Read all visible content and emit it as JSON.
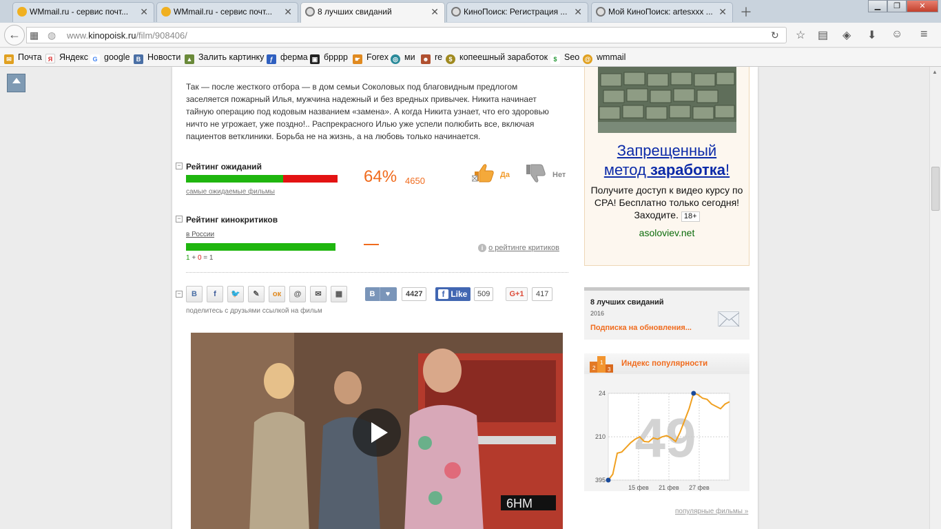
{
  "browser": {
    "tabs": [
      {
        "title": "WMmail.ru - сервис почт...",
        "active": false
      },
      {
        "title": "WMmail.ru - сервис почт...",
        "active": false
      },
      {
        "title": "8 лучших свиданий",
        "active": true
      },
      {
        "title": "КиноПоиск: Регистрация ...",
        "active": false
      },
      {
        "title": "Мой КиноПоиск: artesxxx ...",
        "active": false
      }
    ],
    "url_plain": "www.",
    "url_domain": "kinopoisk.ru",
    "url_path": "/film/908406/",
    "bookmarks": [
      {
        "label": "Почта",
        "icon": "mail-icon",
        "color": "#e0a020"
      },
      {
        "label": "Яндекс",
        "icon": "yandex-icon",
        "color": "#d92c2c"
      },
      {
        "label": "google",
        "icon": "google-icon",
        "color": "#4285f4"
      },
      {
        "label": "Новости",
        "icon": "vk-icon",
        "color": "#4a6fa5"
      },
      {
        "label": "Залить картинку",
        "icon": "upload-icon",
        "color": "#6a8a3a"
      },
      {
        "label": "ферма",
        "icon": "farm-icon",
        "color": "#3060c0"
      },
      {
        "label": "бpppp",
        "icon": "film-icon",
        "color": "#222222"
      },
      {
        "label": "Forex",
        "icon": "forex-icon",
        "color": "#e08a20"
      },
      {
        "label": "ми",
        "icon": "globe-icon",
        "color": "#2a8a9a"
      },
      {
        "label": "re",
        "icon": "person-icon",
        "color": "#b05030"
      },
      {
        "label": "копеешный заработок",
        "icon": "coin-icon",
        "color": "#a08a20"
      },
      {
        "label": "Seo",
        "icon": "seo-icon",
        "color": "#2a9a3a"
      },
      {
        "label": "wmmail",
        "icon": "wmmail-icon",
        "color": "#e0a020"
      }
    ]
  },
  "film": {
    "description": "Так — после жесткого отбора — в дом семьи Соколовых под благовидным предлогом заселяется пожарный Илья, мужчина надежный и без вредных привычек. Никита начинает тайную операцию под кодовым названием «замена». А когда Никита узнает, что его здоровью ничто не угрожает, уже поздно!.. Распрекрасного Илью уже успели полюбить все, включая пациентов ветклиники. Борьба не на жизнь, а на любовь только начинается."
  },
  "rating_wait": {
    "title": "Рейтинг ожиданий",
    "percent": "64%",
    "percent_value": 64,
    "count": "4650",
    "link": "самые ожидаемые фильмы",
    "yes": "Да",
    "no": "Нет"
  },
  "rating_critics": {
    "title": "Рейтинг кинокритиков",
    "region": "в России",
    "formula_pos": "1",
    "formula_plus": " + ",
    "formula_neg": "0",
    "formula_eq": " = 1",
    "score": "—",
    "about": "о рейтинге критиков"
  },
  "share": {
    "text": "поделитесь с друзьями ссылкой на фильм",
    "vk_label": "В",
    "vk_count": "4427",
    "fb_label": "Like",
    "fb_count": "509",
    "gplus_label": "G+1",
    "gplus_count": "417"
  },
  "ad": {
    "headline_1": "Запрещенный",
    "headline_2": "метод ",
    "headline_bold": "заработка",
    "headline_end": "!",
    "text": "Получите доступ к видео курсу по CPA! Бесплатно только сегодня! Заходите.",
    "age": "18+",
    "site": "asoloviev.net"
  },
  "subscription": {
    "title": "8 лучших свиданий",
    "year": "2016",
    "link": "Подписка на обновления..."
  },
  "popularity": {
    "title": "Индекс популярности",
    "big_number": "49",
    "more_link": "популярные фильмы »"
  },
  "chart_data": {
    "type": "line",
    "title": "Индекс популярности",
    "y_reversed": true,
    "y_ticks": [
      24,
      210,
      395
    ],
    "ylim": [
      24,
      395
    ],
    "x_ticks": [
      "15 фев",
      "21 фев",
      "27 фев"
    ],
    "series": [
      {
        "values": [
          395,
          370,
          280,
          275,
          255,
          235,
          220,
          210,
          230,
          232,
          215,
          220,
          210,
          205,
          215,
          230,
          190,
          140,
          90,
          24,
          30,
          45,
          50,
          70,
          80,
          90,
          70,
          60
        ]
      }
    ],
    "highlight_first": true,
    "highlight_max_index": 19,
    "line_color": "#f0a020",
    "marker_color": "#1a4a9a"
  }
}
